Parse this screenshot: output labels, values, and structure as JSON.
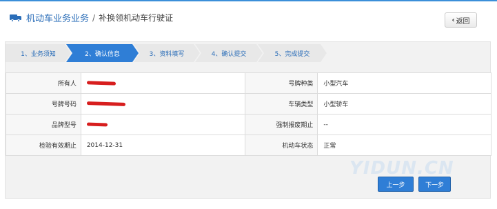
{
  "header": {
    "breadcrumb_main": "机动车业务业务",
    "breadcrumb_separator": "/",
    "breadcrumb_sub": "补换领机动车行驶证",
    "back_label": "返回",
    "icon": "truck-icon"
  },
  "steps": [
    {
      "label": "1、业务须知",
      "active": false
    },
    {
      "label": "2、确认信息",
      "active": true
    },
    {
      "label": "3、资料填写",
      "active": false
    },
    {
      "label": "4、确认提交",
      "active": false
    },
    {
      "label": "5、完成提交",
      "active": false
    }
  ],
  "info": {
    "rows": [
      {
        "label1": "所有人",
        "value1": "",
        "label2": "号牌种类",
        "value2": "小型汽车"
      },
      {
        "label1": "号牌号码",
        "value1": "",
        "label2": "车辆类型",
        "value2": "小型轿车"
      },
      {
        "label1": "品牌型号",
        "value1": "",
        "label2": "强制报废期止",
        "value2": "--"
      },
      {
        "label1": "检验有效期止",
        "value1": "2014-12-31",
        "label2": "机动车状态",
        "value2": "正常"
      }
    ]
  },
  "buttons": {
    "prev": "上一步",
    "next": "下一步"
  },
  "colors": {
    "accent": "#2f7ed6",
    "redaction": "#d71e1e"
  },
  "watermark": "YIDUN.CN"
}
